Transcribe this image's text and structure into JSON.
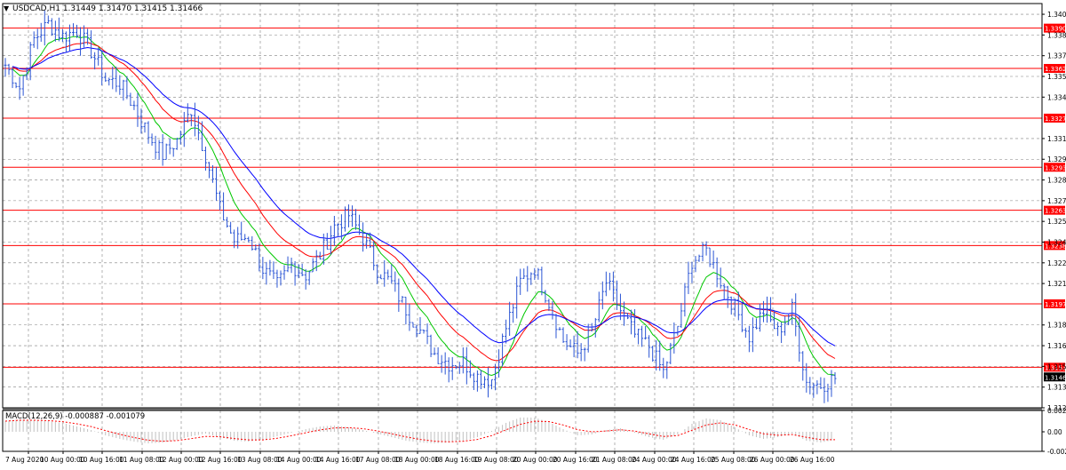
{
  "window": {
    "symbol_info": "USDCAD,H1  1.31449 1.31470 1.31415 1.31466",
    "collapse_icon": "triangle-down-icon"
  },
  "chart_data": [
    {
      "type": "candlestick-bars",
      "symbol": "USDCAD",
      "timeframe": "H1",
      "ohlc": {
        "open": 1.31449,
        "high": 1.3147,
        "low": 1.31415,
        "close": 1.31466
      },
      "ylim": [
        1.3125,
        1.3408
      ],
      "y_ticks": [
        "1.34005",
        "1.33860",
        "1.33715",
        "1.33570",
        "1.33425",
        "1.33135",
        "1.32990",
        "1.32845",
        "1.32700",
        "1.32555",
        "1.32410",
        "1.32265",
        "1.32120",
        "1.31830",
        "1.31685",
        "1.31540",
        "1.31395",
        "1.31250"
      ],
      "x_ticks": [
        "7 Aug 2020",
        "10 Aug 00:00",
        "10 Aug 16:00",
        "11 Aug 08:00",
        "12 Aug 00:00",
        "12 Aug 16:00",
        "13 Aug 08:00",
        "14 Aug 00:00",
        "14 Aug 16:00",
        "17 Aug 08:00",
        "18 Aug 00:00",
        "18 Aug 16:00",
        "19 Aug 08:00",
        "20 Aug 00:00",
        "20 Aug 16:00",
        "21 Aug 08:00",
        "24 Aug 00:00",
        "24 Aug 16:00",
        "25 Aug 08:00",
        "26 Aug 00:00",
        "26 Aug 16:00"
      ],
      "horizontal_levels": [
        "1.33908",
        "1.33626",
        "1.33278",
        "1.32934",
        "1.32633",
        "1.32386",
        "1.31978",
        "1.31534"
      ],
      "current_price": "1.31466",
      "price_path": [
        [
          0,
          1.3365
        ],
        [
          4,
          1.3349
        ],
        [
          8,
          1.3383
        ],
        [
          12,
          1.3394
        ],
        [
          16,
          1.3385
        ],
        [
          20,
          1.3389
        ],
        [
          24,
          1.3375
        ],
        [
          28,
          1.3355
        ],
        [
          32,
          1.3352
        ],
        [
          36,
          1.3336
        ],
        [
          40,
          1.3316
        ],
        [
          44,
          1.3302
        ],
        [
          48,
          1.3312
        ],
        [
          52,
          1.3334
        ],
        [
          56,
          1.3302
        ],
        [
          60,
          1.3264
        ],
        [
          64,
          1.3242
        ],
        [
          68,
          1.3245
        ],
        [
          72,
          1.3222
        ],
        [
          76,
          1.3211
        ],
        [
          80,
          1.3225
        ],
        [
          84,
          1.3218
        ],
        [
          88,
          1.3232
        ],
        [
          92,
          1.3252
        ],
        [
          96,
          1.326
        ],
        [
          100,
          1.3244
        ],
        [
          104,
          1.3222
        ],
        [
          108,
          1.3212
        ],
        [
          112,
          1.3194
        ],
        [
          116,
          1.3179
        ],
        [
          120,
          1.3163
        ],
        [
          124,
          1.3156
        ],
        [
          128,
          1.3157
        ],
        [
          132,
          1.3147
        ],
        [
          136,
          1.3145
        ],
        [
          140,
          1.3181
        ],
        [
          144,
          1.3213
        ],
        [
          148,
          1.3223
        ],
        [
          152,
          1.3199
        ],
        [
          156,
          1.3172
        ],
        [
          160,
          1.3163
        ],
        [
          164,
          1.3178
        ],
        [
          168,
          1.3213
        ],
        [
          172,
          1.3193
        ],
        [
          176,
          1.3176
        ],
        [
          180,
          1.3168
        ],
        [
          184,
          1.315
        ],
        [
          188,
          1.3182
        ],
        [
          192,
          1.3228
        ],
        [
          196,
          1.3235
        ],
        [
          200,
          1.3214
        ],
        [
          204,
          1.3195
        ],
        [
          208,
          1.3175
        ],
        [
          212,
          1.3193
        ],
        [
          216,
          1.3178
        ],
        [
          220,
          1.3194
        ],
        [
          224,
          1.3143
        ],
        [
          228,
          1.3141
        ],
        [
          232,
          1.3146
        ]
      ],
      "series": [
        {
          "name": "MA fast",
          "color": "#00c800"
        },
        {
          "name": "MA mid",
          "color": "#ff0000"
        },
        {
          "name": "MA slow",
          "color": "#0000ff"
        }
      ],
      "bar_color": "#2b55d4",
      "level_color": "#ff0000"
    },
    {
      "type": "histogram",
      "indicator_label": "MACD(12,26,9) -0.000887 -0.001079",
      "ylim": [
        -0.00219,
        0.00239
      ],
      "y_ticks": [
        "0.002397",
        "0.00",
        "-0.00219"
      ],
      "macd_values": [
        0.0012,
        0.0014,
        0.0013,
        0.0012,
        0.001,
        0.0006,
        0.0002,
        -0.0004,
        -0.0008,
        -0.0011,
        -0.0013,
        -0.0012,
        -0.0009,
        -0.0005,
        -0.0002,
        -0.0006,
        -0.001,
        -0.0011,
        -0.0009,
        -0.0005,
        -0.0001,
        0.0003,
        0.0006,
        0.0007,
        0.0005,
        0.0002,
        -0.0002,
        -0.0006,
        -0.001,
        -0.0012,
        -0.0013,
        -0.0012,
        -0.001,
        -0.0006,
        0.0001,
        0.001,
        0.0016,
        0.0016,
        0.0011,
        0.0003,
        -0.0004,
        -0.0003,
        0.0002,
        0.0004,
        -0.0001,
        -0.0006,
        -0.0009,
        -0.0003,
        0.0009,
        0.0015,
        0.0013,
        0.0005,
        -0.0004,
        -0.0008,
        -0.0006,
        -0.0002,
        -0.001,
        -0.0012,
        -0.0009
      ],
      "hist_color": "#c0c0c0",
      "signal_color": "#ff0000"
    }
  ],
  "colors": {
    "background": "#ffffff",
    "grid": "#808080",
    "axis": "#000000",
    "price_label_bg": "#ff0000",
    "current_label_bg": "#000000"
  }
}
